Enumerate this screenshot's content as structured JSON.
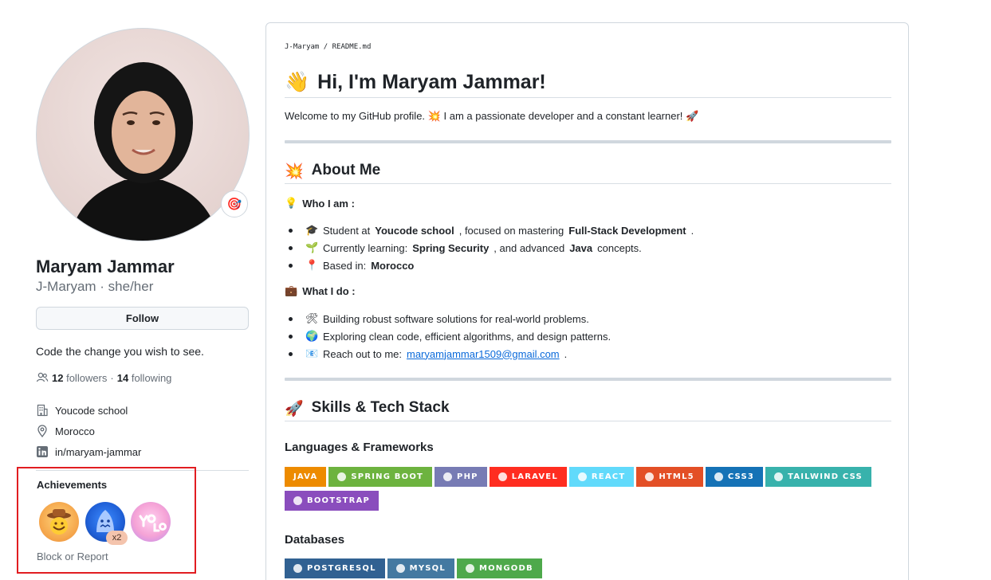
{
  "profile": {
    "name": "Maryam Jammar",
    "login_line": "J-Maryam · she/her",
    "status_emoji": "🎯",
    "follow_label": "Follow",
    "bio": "Code the change you wish to see.",
    "followers_count": "12",
    "followers_label": "followers",
    "separator": "·",
    "following_count": "14",
    "following_label": "following",
    "company": "Youcode school",
    "location": "Morocco",
    "linkedin": "in/maryam-jammar"
  },
  "achievements": {
    "title": "Achievements",
    "badges": [
      {
        "icon": "cowboy-achievement-icon"
      },
      {
        "icon": "shark-achievement-icon",
        "count": "x2"
      },
      {
        "icon": "yolo-achievement-icon"
      }
    ],
    "block_report": "Block or Report"
  },
  "readme": {
    "crumb_user": "J-Maryam",
    "crumb_sep": "/",
    "crumb_file": "README.md",
    "h1_emoji": "👋",
    "h1": "Hi, I'm Maryam Jammar!",
    "intro_a": "Welcome to my GitHub profile.",
    "intro_emoji1": "💥",
    "intro_b": "I am a passionate developer and a constant learner!",
    "intro_emoji2": "🚀",
    "about_emoji": "💥",
    "about_title": "About Me",
    "who_emoji": "💡",
    "who_title": "Who I am :",
    "who_items": [
      {
        "emoji": "🎓",
        "pre": "Student at",
        "b1": "Youcode school",
        "mid": ", focused on mastering",
        "b2": "Full-Stack Development",
        "post": "."
      },
      {
        "emoji": "🌱",
        "pre": "Currently learning:",
        "b1": "Spring Security",
        "mid": ", and advanced",
        "b2": "Java",
        "post": "concepts."
      },
      {
        "emoji": "📍",
        "pre": "Based in:",
        "b1": "Morocco",
        "mid": "",
        "b2": "",
        "post": ""
      }
    ],
    "do_emoji": "💼",
    "do_title": "What I do :",
    "do_items": [
      {
        "emoji": "🛠",
        "text": "Building robust software solutions for real-world problems."
      },
      {
        "emoji": "🌍",
        "text": "Exploring clean code, efficient algorithms, and design patterns."
      }
    ],
    "reach_emoji": "📧",
    "reach_text": "Reach out to me:",
    "reach_email": "maryamjammar1509@gmail.com",
    "reach_post": ".",
    "skills_emoji": "🚀",
    "skills_title": "Skills & Tech Stack",
    "lang_title": "Languages & Frameworks",
    "lang_badges": [
      {
        "label": "JAVA",
        "color": "#ED8B00",
        "icon": "java-icon"
      },
      {
        "label": "SPRING BOOT",
        "color": "#6DB33F",
        "icon": "spring-icon"
      },
      {
        "label": "PHP",
        "color": "#777BB4",
        "icon": "php-icon"
      },
      {
        "label": "LARAVEL",
        "color": "#FF2D20",
        "icon": "laravel-icon"
      },
      {
        "label": "REACT",
        "color": "#61DAFB",
        "icon": "react-icon"
      },
      {
        "label": "HTML5",
        "color": "#E34F26",
        "icon": "html5-icon"
      },
      {
        "label": "CSS3",
        "color": "#1572B6",
        "icon": "css3-icon"
      },
      {
        "label": "TAILWIND CSS",
        "color": "#38B2AC",
        "icon": "tailwind-icon"
      },
      {
        "label": "BOOTSTRAP",
        "color": "#8A4DBD",
        "icon": "bootstrap-icon"
      }
    ],
    "db_title": "Databases",
    "db_badges": [
      {
        "label": "POSTGRESQL",
        "color": "#316192",
        "icon": "postgresql-icon"
      },
      {
        "label": "MYSQL",
        "color": "#4479A1",
        "icon": "mysql-icon"
      },
      {
        "label": "MONGODB",
        "color": "#4EA94B",
        "icon": "mongodb-icon"
      }
    ]
  }
}
